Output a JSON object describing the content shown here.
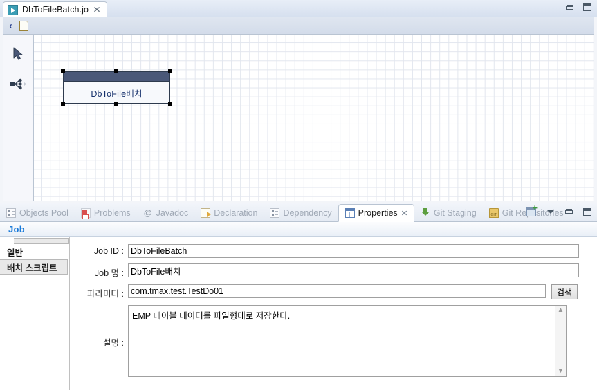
{
  "editor": {
    "tab": {
      "label": "DbToFileBatch.jo",
      "icon": "job-file-icon",
      "close": "✕"
    },
    "toolbar": {
      "back": "‹",
      "doc_icon": "document-icon"
    },
    "window_controls": {
      "minimize": "minimize-icon",
      "maximize": "maximize-icon"
    },
    "palette": [
      {
        "name": "select-tool",
        "icon": "arrow-cursor-icon"
      },
      {
        "name": "connection-tool",
        "icon": "branch-node-icon"
      }
    ],
    "canvas": {
      "node": {
        "label": "DbToFile배치",
        "selected": true
      }
    }
  },
  "views": {
    "tabs": [
      {
        "label": "Objects Pool",
        "icon": "objects-pool-icon",
        "active": false
      },
      {
        "label": "Problems",
        "icon": "problems-icon",
        "active": false
      },
      {
        "label": "Javadoc",
        "icon": "javadoc-icon",
        "active": false
      },
      {
        "label": "Declaration",
        "icon": "declaration-icon",
        "active": false
      },
      {
        "label": "Dependency",
        "icon": "dependency-icon",
        "active": false
      },
      {
        "label": "Properties",
        "icon": "properties-icon",
        "active": true,
        "close": "✕"
      },
      {
        "label": "Git Staging",
        "icon": "git-staging-icon",
        "active": false
      },
      {
        "label": "Git Repositories",
        "icon": "git-repositories-icon",
        "active": false
      }
    ],
    "controls": {
      "new_view": "new-view-icon",
      "view_menu": "chevron-down-icon",
      "minimize": "minimize-icon",
      "maximize": "maximize-icon"
    }
  },
  "properties": {
    "title": "Job",
    "side_tabs": [
      {
        "label": "일반",
        "selected": true
      },
      {
        "label": "배치 스크립트",
        "selected": false
      }
    ],
    "fields": {
      "job_id": {
        "label": "Job ID :",
        "value": "DbToFileBatch"
      },
      "job_name": {
        "label": "Job 명 :",
        "value": "DbToFile배치"
      },
      "parameter": {
        "label": "파라미터 :",
        "value": "com.tmax.test.TestDo01",
        "button": "검색"
      },
      "description": {
        "label": "설명 :",
        "value": "EMP 테이블 데이터를 파일형태로 저장한다."
      }
    },
    "scroll": {
      "up": "▲",
      "down": "▼"
    }
  }
}
